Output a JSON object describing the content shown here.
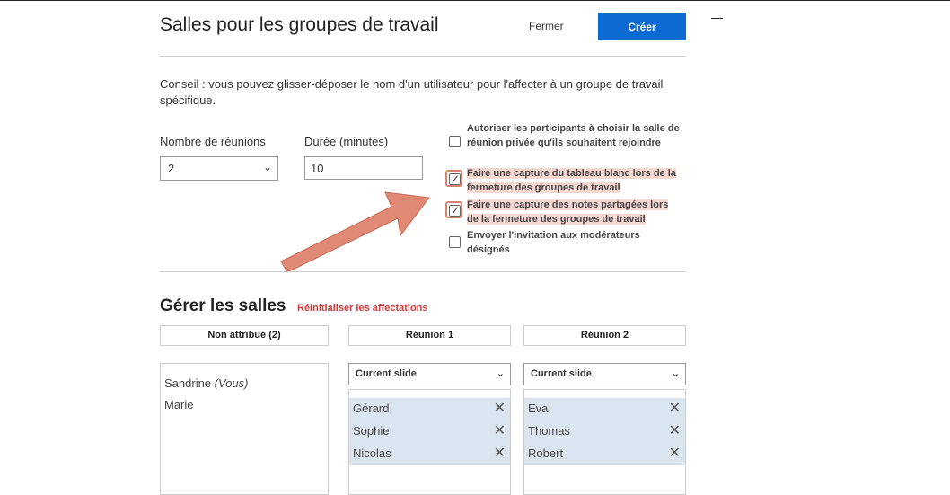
{
  "header": {
    "title": "Salles pour les groupes de travail",
    "close_label": "Fermer",
    "create_label": "Créer"
  },
  "tip": "Conseil : vous pouvez glisser-déposer le nom d'un utilisateur pour l'affecter à un groupe de travail spécifique.",
  "settings": {
    "meetings_label": "Nombre de réunions",
    "meetings_value": "2",
    "duration_label": "Durée (minutes)",
    "duration_value": "10"
  },
  "options": [
    {
      "label": "Autoriser les participants à choisir la salle de réunion privée qu'ils souhaitent rejoindre",
      "checked": false,
      "highlighted": false
    },
    {
      "label": "Faire une capture du tableau blanc lors de la fermeture des groupes de travail",
      "checked": true,
      "highlighted": true
    },
    {
      "label": "Faire une capture des notes partagées lors de la fermeture des groupes de travail",
      "checked": true,
      "highlighted": true
    },
    {
      "label": "Envoyer l'invitation aux modérateurs désignés",
      "checked": false,
      "highlighted": false
    }
  ],
  "rooms": {
    "title": "Gérer les salles",
    "reset_label": "Réinitialiser les affectations",
    "unassigned": {
      "header": "Non attribué (2)",
      "users": [
        {
          "name": "Sandrine",
          "suffix": "(Vous)"
        },
        {
          "name": "Marie",
          "suffix": ""
        }
      ]
    },
    "meeting1": {
      "header": "Réunion 1",
      "slide": "Current slide",
      "users": [
        "Gérard",
        "Sophie",
        "Nicolas"
      ]
    },
    "meeting2": {
      "header": "Réunion 2",
      "slide": "Current slide",
      "users": [
        "Eva",
        "Thomas",
        "Robert"
      ]
    }
  },
  "colors": {
    "primary": "#0b6bd3",
    "reset": "#d03b3b",
    "highlight": "#f6d8d2",
    "arrow": "#e08a76",
    "assigned_row": "#dbe5ef"
  }
}
